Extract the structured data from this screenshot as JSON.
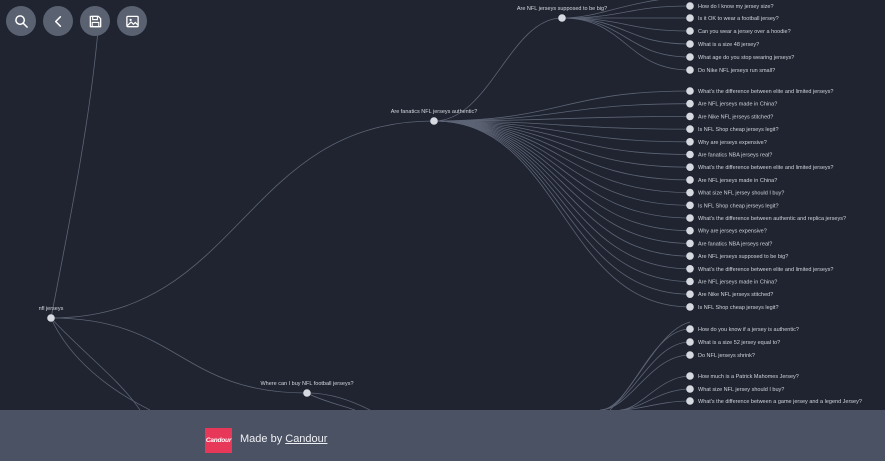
{
  "toolbar": {
    "search_icon": "search-icon",
    "back_icon": "chevron-left-icon",
    "save_icon": "save-icon",
    "image_icon": "image-icon"
  },
  "tree": {
    "root": "nfl jerseys",
    "branches": {
      "supposed_big": "Are NFL jerseys supposed to be big?",
      "fanatics": "Are fanatics NFL jerseys authentic?",
      "where_buy": "Where can I buy NFL football jerseys?"
    },
    "leaves_supposed_big": [
      "How do I know my jersey size?",
      "Is it OK to wear a football jersey?",
      "Can you wear a jersey over a hoodie?",
      "What is a size 48 jersey?",
      "What age do you stop wearing jerseys?",
      "Do Nike NFL jerseys run small?"
    ],
    "leaves_fanatics": [
      "What's the difference between elite and limited jerseys?",
      "Are NFL jerseys made in China?",
      "Are Nike NFL jerseys stitched?",
      "Is NFL Shop cheap jerseys legit?",
      "Why are jerseys expensive?",
      "Are fanatics NBA jerseys real?",
      "What's the difference between elite and limited jerseys?",
      "Are NFL jerseys made in China?",
      "What size NFL jersey should I buy?",
      "Is NFL Shop cheap jerseys legit?",
      "What's the difference between authentic and replica jerseys?",
      "Why are jerseys expensive?",
      "Are fanatics NBA jerseys real?",
      "Are NFL jerseys supposed to be big?",
      "What's the difference between elite and limited jerseys?",
      "Are NFL jerseys made in China?",
      "Are Nike NFL jerseys stitched?",
      "Is NFL Shop cheap jerseys legit?"
    ],
    "leaves_group3": [
      "How do you know if a jersey is authentic?",
      "What is a size 52 jersey equal to?",
      "Do NFL jerseys shrink?"
    ],
    "leaves_group4": [
      "How much is a Patrick Mahomes Jersey?",
      "What size NFL jersey should I buy?",
      "What's the difference between a game jersey and a legend Jersey?"
    ]
  },
  "footer": {
    "logo_text": "Candour",
    "made_by": "Made by ",
    "link": "Candour"
  }
}
